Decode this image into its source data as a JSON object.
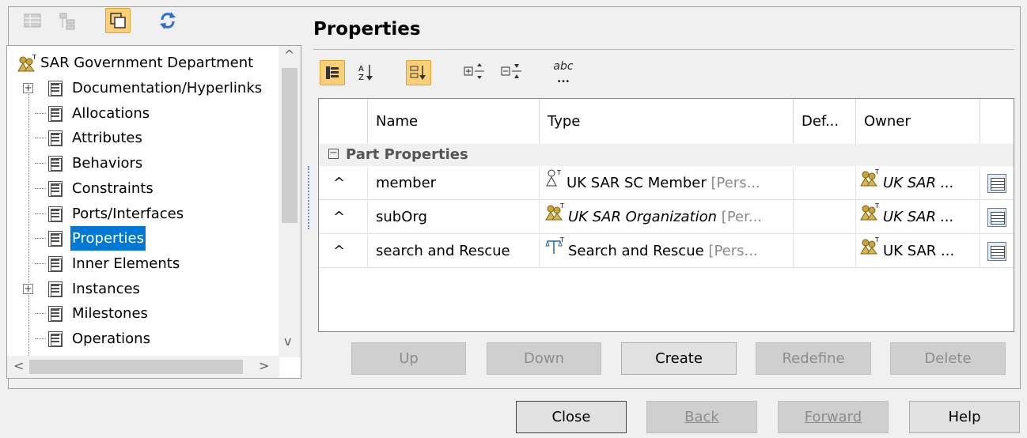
{
  "toolbar_left": {
    "icons": [
      "table-view-icon",
      "tree-view-icon",
      "window-toggle-icon",
      "refresh-icon"
    ]
  },
  "tree": {
    "root": "SAR Government Department",
    "items": [
      {
        "label": "Documentation/Hyperlinks",
        "expandable": true
      },
      {
        "label": "Allocations",
        "expandable": false
      },
      {
        "label": "Attributes",
        "expandable": false
      },
      {
        "label": "Behaviors",
        "expandable": false
      },
      {
        "label": "Constraints",
        "expandable": false
      },
      {
        "label": "Ports/Interfaces",
        "expandable": false
      },
      {
        "label": "Properties",
        "expandable": false,
        "selected": true
      },
      {
        "label": "Inner Elements",
        "expandable": false
      },
      {
        "label": "Instances",
        "expandable": true
      },
      {
        "label": "Milestones",
        "expandable": false
      },
      {
        "label": "Operations",
        "expandable": false
      }
    ]
  },
  "panel": {
    "title": "Properties"
  },
  "toolbar_right": {
    "icons": [
      "group-by-icon",
      "sort-alpha-icon",
      "sort-category-icon",
      "expand-all-icon",
      "collapse-all-icon",
      "abc-options-icon"
    ],
    "abc_label": "abc"
  },
  "table": {
    "columns": [
      "Name",
      "Type",
      "Def...",
      "Owner"
    ],
    "group": "Part Properties",
    "rows": [
      {
        "marker": "^",
        "name": "member",
        "type": "UK SAR SC Member",
        "type_suffix": "[Pers...",
        "type_icon": "actor-icon",
        "type_italic": false,
        "owner": "UK SAR ...",
        "owner_italic": true
      },
      {
        "marker": "^",
        "name": "subOrg",
        "type": "UK SAR Organization",
        "type_suffix": "[Per...",
        "type_icon": "organization-icon",
        "type_italic": true,
        "owner": "UK SAR ...",
        "owner_italic": true
      },
      {
        "marker": "^",
        "name": "search and Rescue",
        "type": "Search and Rescue",
        "type_suffix": "[Pers...",
        "type_icon": "capability-icon",
        "type_italic": false,
        "owner": "UK SAR ...",
        "owner_italic": false
      }
    ]
  },
  "actions": {
    "up": "Up",
    "down": "Down",
    "create": "Create",
    "redefine": "Redefine",
    "delete": "Delete"
  },
  "dialog": {
    "close": "Close",
    "back": "Back",
    "forward": "Forward",
    "help": "Help"
  },
  "colors": {
    "selection": "#0078d7",
    "toggle_active": "#f9cf78",
    "org_icon": "#b8962e"
  }
}
